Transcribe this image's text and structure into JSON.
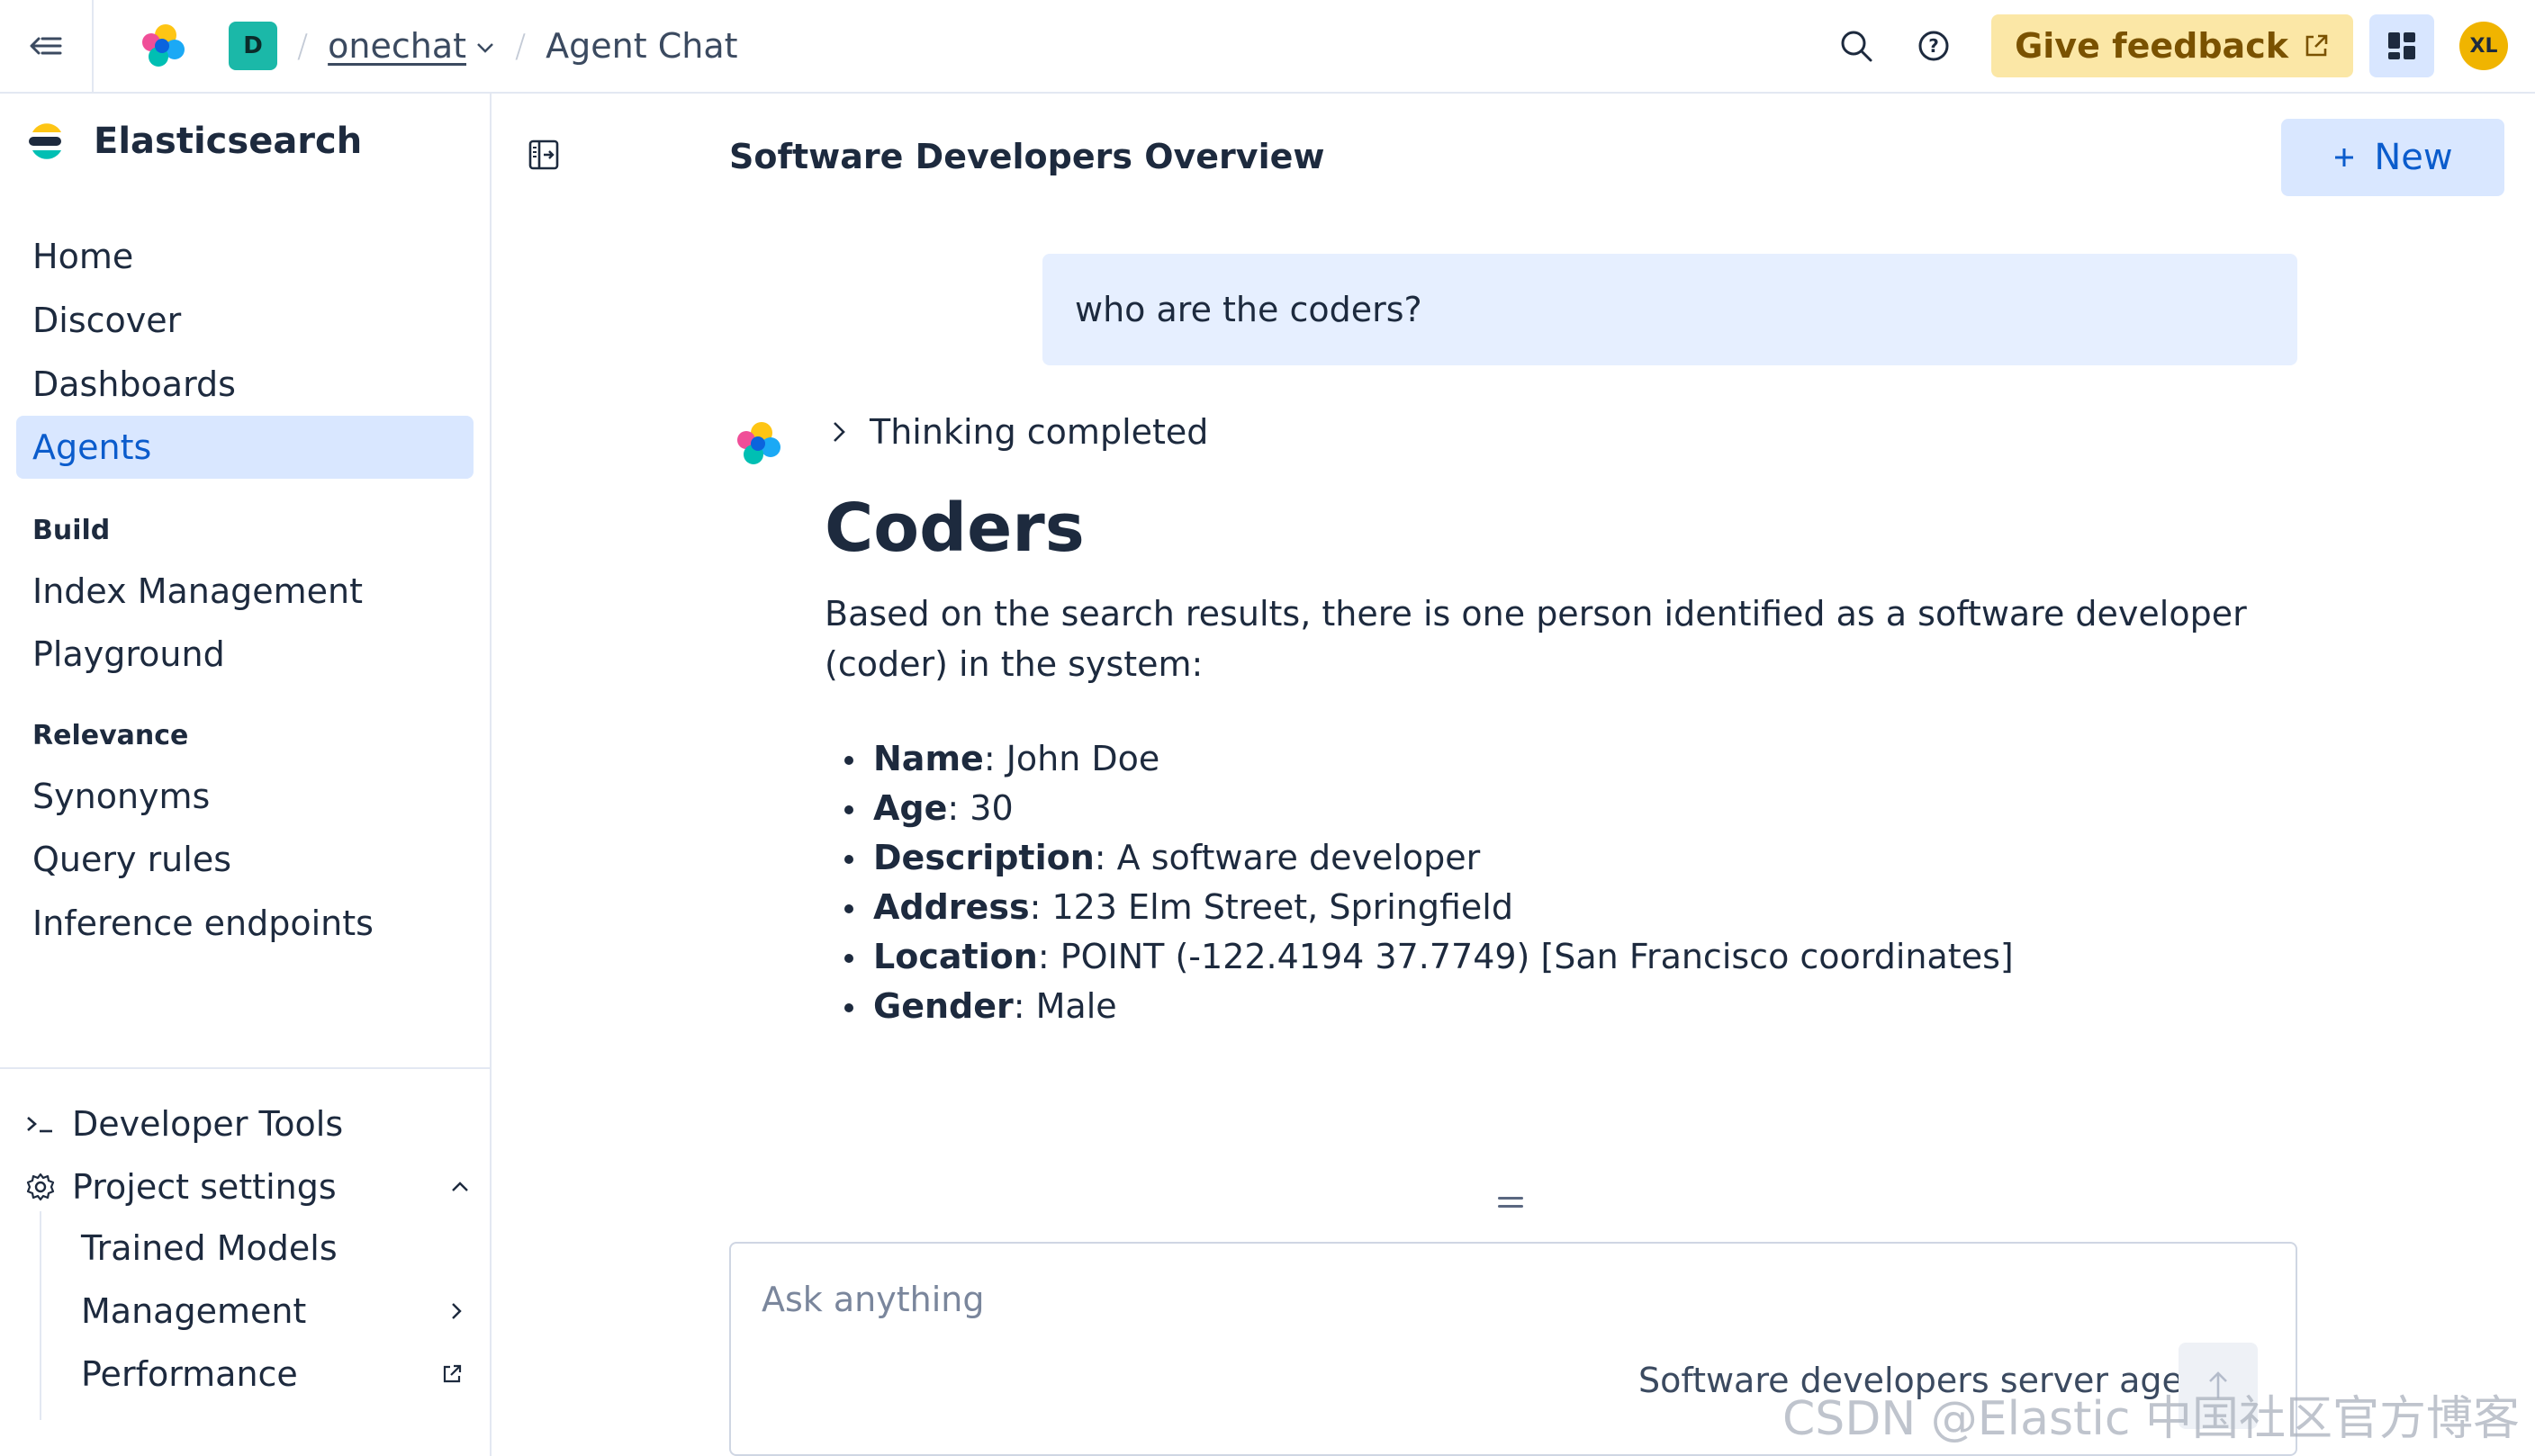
{
  "header": {
    "space_initial": "D",
    "breadcrumb_link": "onechat",
    "breadcrumb_current": "Agent Chat",
    "feedback_label": "Give feedback",
    "avatar_initials": "XL"
  },
  "sidebar": {
    "brand": "Elasticsearch",
    "nav": [
      "Home",
      "Discover",
      "Dashboards",
      "Agents"
    ],
    "active": "Agents",
    "groups": {
      "build": {
        "title": "Build",
        "items": [
          "Index Management",
          "Playground"
        ]
      },
      "relevance": {
        "title": "Relevance",
        "items": [
          "Synonyms",
          "Query rules",
          "Inference endpoints"
        ]
      }
    },
    "footer": {
      "developer_tools": "Developer Tools",
      "project_settings": "Project settings",
      "sub_items": [
        "Trained Models",
        "Management",
        "Performance"
      ]
    }
  },
  "main": {
    "title": "Software Developers Overview",
    "new_label": "New",
    "user_message": "who are the coders?",
    "thinking_label": "Thinking completed",
    "answer": {
      "heading": "Coders",
      "intro": "Based on the search results, there is one person identified as a software developer (coder) in the system:",
      "fields": [
        {
          "key": "Name",
          "value": ": John Doe"
        },
        {
          "key": "Age",
          "value": ": 30"
        },
        {
          "key": "Description",
          "value": ": A software developer"
        },
        {
          "key": "Address",
          "value": ": 123 Elm Street, Springfield"
        },
        {
          "key": "Location",
          "value": ": POINT (-122.4194 37.7749) [San Francisco coordinates]"
        },
        {
          "key": "Gender",
          "value": ": Male"
        }
      ]
    },
    "composer": {
      "placeholder": "Ask anything",
      "value": "",
      "agent_label": "Software developers server agent"
    }
  },
  "watermark": "CSDN @Elastic 中国社区官方博客",
  "colors": {
    "accent": "#0b5ccc",
    "active_bg": "#d9e7ff",
    "feedback_bg": "#fbe7a6",
    "space_badge": "#1bb8a8",
    "avatar": "#f0b400"
  }
}
